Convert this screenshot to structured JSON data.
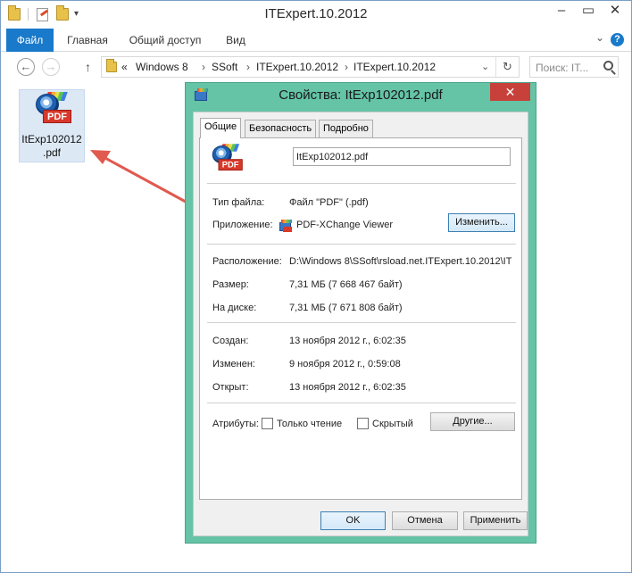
{
  "explorer": {
    "title": "ITExpert.10.2012",
    "ribbon_tabs": [
      "Файл",
      "Главная",
      "Общий доступ",
      "Вид"
    ],
    "address": {
      "prefix": "«",
      "crumbs": [
        "Windows 8",
        "SSoft",
        "ITExpert.10.2012",
        "ITExpert.10.2012"
      ],
      "separator": "›"
    },
    "search_placeholder": "Поиск: IT...",
    "file": {
      "name_line1": "ItExp102012",
      "name_line2": ".pdf",
      "icon": "pdf-icon"
    }
  },
  "dialog": {
    "title": "Свойства: ItExp102012.pdf",
    "tabs": [
      "Общие",
      "Безопасность",
      "Подробно"
    ],
    "filename": "ItExp102012.pdf",
    "file_type_label": "Тип файла:",
    "file_type_value": "Файл \"PDF\" (.pdf)",
    "app_label": "Приложение:",
    "app_value": "PDF-XChange Viewer",
    "change_button": "Изменить...",
    "location_label": "Расположение:",
    "location_value": "D:\\Windows 8\\SSoft\\rsload.net.ITExpert.10.2012\\IT",
    "size_label": "Размер:",
    "size_value": "7,31 МБ (7 668 467 байт)",
    "disk_label": "На диске:",
    "disk_value": "7,31 МБ (7 671 808 байт)",
    "created_label": "Создан:",
    "created_value": "13 ноября 2012 г., 6:02:35",
    "modified_label": "Изменен:",
    "modified_value": "9 ноября 2012 г., 0:59:08",
    "opened_label": "Открыт:",
    "opened_value": "13 ноября 2012 г., 6:02:35",
    "attributes_label": "Атрибуты:",
    "readonly_label": "Только чтение",
    "hidden_label": "Скрытый",
    "other_button": "Другие...",
    "ok_button": "OK",
    "cancel_button": "Отмена",
    "apply_button": "Применить"
  },
  "colors": {
    "accent": "#1979ca",
    "dialog_frame": "#65c3a6",
    "close": "#c7413a",
    "arrow": "#e05a4f"
  }
}
